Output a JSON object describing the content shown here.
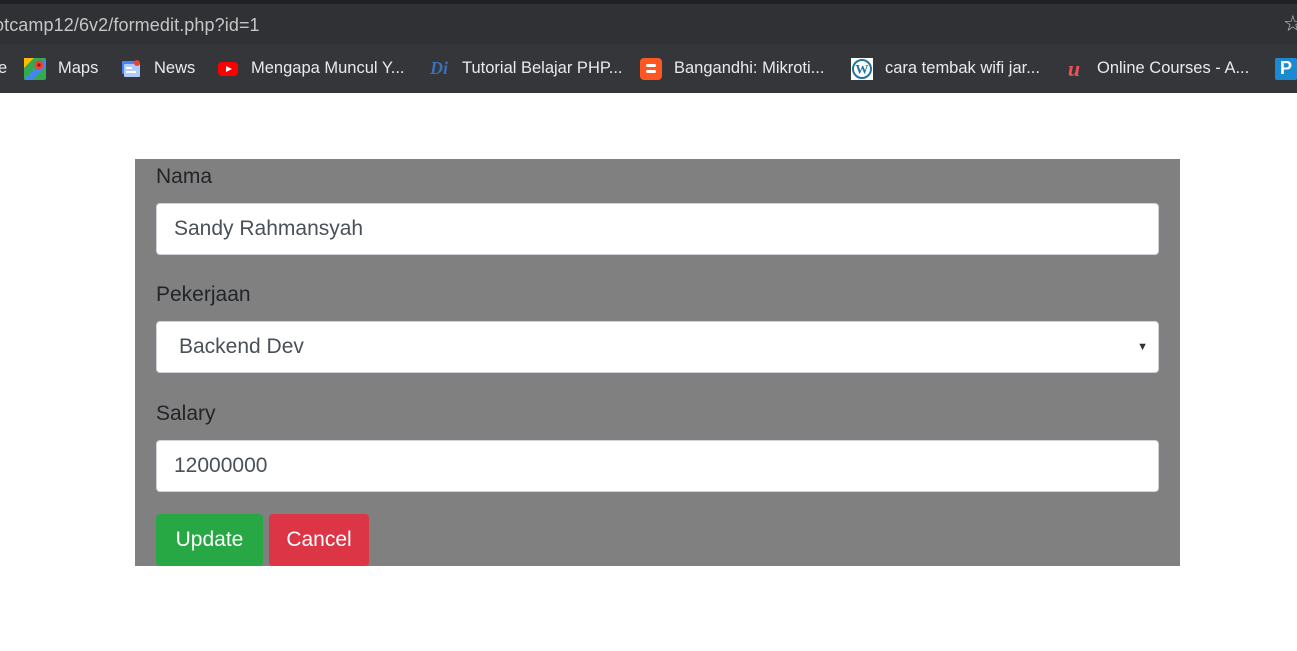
{
  "browser": {
    "url": "otcamp12/6v2/formedit.php?id=1",
    "bookmarks": [
      {
        "label": "Maps",
        "icon": "google-maps-icon"
      },
      {
        "label": "News",
        "icon": "google-news-icon"
      },
      {
        "label": "Mengapa Muncul Y...",
        "icon": "youtube-icon"
      },
      {
        "label": "Tutorial Belajar PHP...",
        "icon": "duniailkom-icon"
      },
      {
        "label": "Bangandhi: Mikroti...",
        "icon": "blogger-icon"
      },
      {
        "label": "cara tembak wifi jar...",
        "icon": "wordpress-icon"
      },
      {
        "label": "Online Courses - A...",
        "icon": "udemy-icon"
      },
      {
        "label": "",
        "icon": "pinterest-icon"
      }
    ],
    "cut_label": "e"
  },
  "form": {
    "nama_label": "Nama",
    "nama_value": "Sandy Rahmansyah",
    "pekerjaan_label": "Pekerjaan",
    "pekerjaan_value": "Backend Dev",
    "salary_label": "Salary",
    "salary_value": "12000000",
    "update_label": "Update",
    "cancel_label": "Cancel"
  },
  "colors": {
    "panel": "#808080",
    "update": "#28a745",
    "cancel": "#dc3545"
  }
}
